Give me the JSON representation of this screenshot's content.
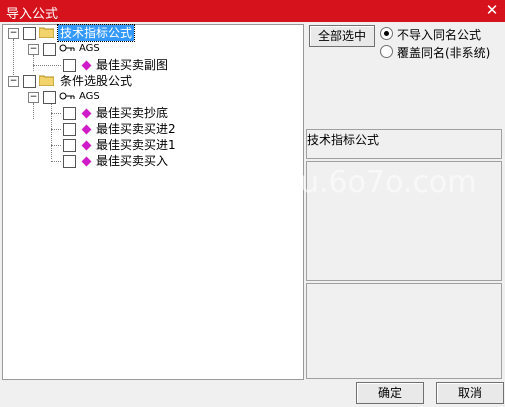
{
  "window": {
    "title": "导入公式",
    "close_label": "✕"
  },
  "tree": {
    "root1": {
      "label": "技术指标公式"
    },
    "root1_child": {
      "label": "AGS"
    },
    "root1_leaf": {
      "label": "最佳买卖副图"
    },
    "root2": {
      "label": "条件选股公式"
    },
    "root2_child": {
      "label": "AGS"
    },
    "root2_leaves": [
      "最佳买卖抄底",
      "最佳买卖买进2",
      "最佳买卖买进1",
      "最佳买卖买入"
    ]
  },
  "actions": {
    "select_all": "全部选中",
    "ok": "确定",
    "cancel": "取消"
  },
  "options": {
    "no_import_same": "不导入同名公式",
    "overwrite_same": "覆盖同名(非系统)",
    "selected": "no_import_same"
  },
  "info": {
    "header": "技术指标公式"
  },
  "watermark": {
    "text": "u.6o7o.com"
  },
  "colors": {
    "title_bar": "#d6121c",
    "selection": "#3399ff",
    "formula_gem": "#d01cc8"
  }
}
